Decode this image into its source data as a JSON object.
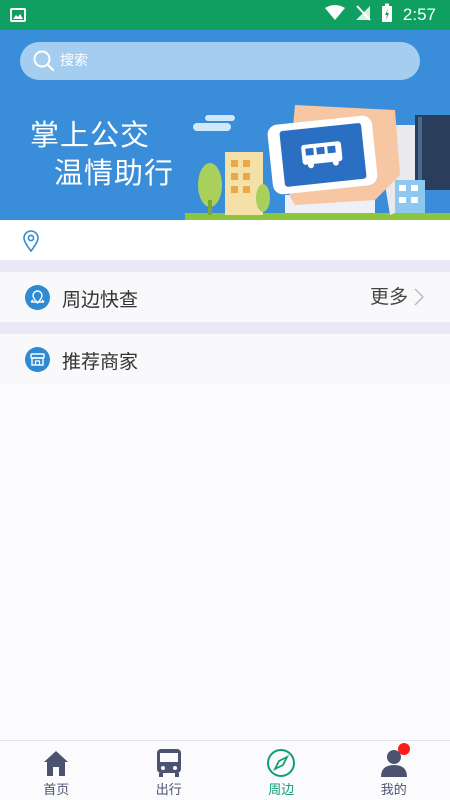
{
  "status_bar": {
    "time": "2:57"
  },
  "search": {
    "placeholder": "搜索"
  },
  "banner": {
    "slogan_line1": "掌上公交",
    "slogan_line2": "温情助行"
  },
  "location": {
    "text": ""
  },
  "sections": {
    "nearby": {
      "label": "周边快查",
      "more": "更多"
    },
    "merchants": {
      "label": "推荐商家"
    }
  },
  "nav": {
    "items": [
      {
        "label": "首页",
        "icon": "home-icon"
      },
      {
        "label": "出行",
        "icon": "bus-icon"
      },
      {
        "label": "周边",
        "icon": "compass-icon"
      },
      {
        "label": "我的",
        "icon": "user-icon"
      }
    ],
    "active": "周边"
  },
  "colors": {
    "status_bar": "#0fa061",
    "banner": "#3a8dd8",
    "accent": "#10a070",
    "icon_blue": "#2f8ad2",
    "badge": "#ff1a1a"
  }
}
